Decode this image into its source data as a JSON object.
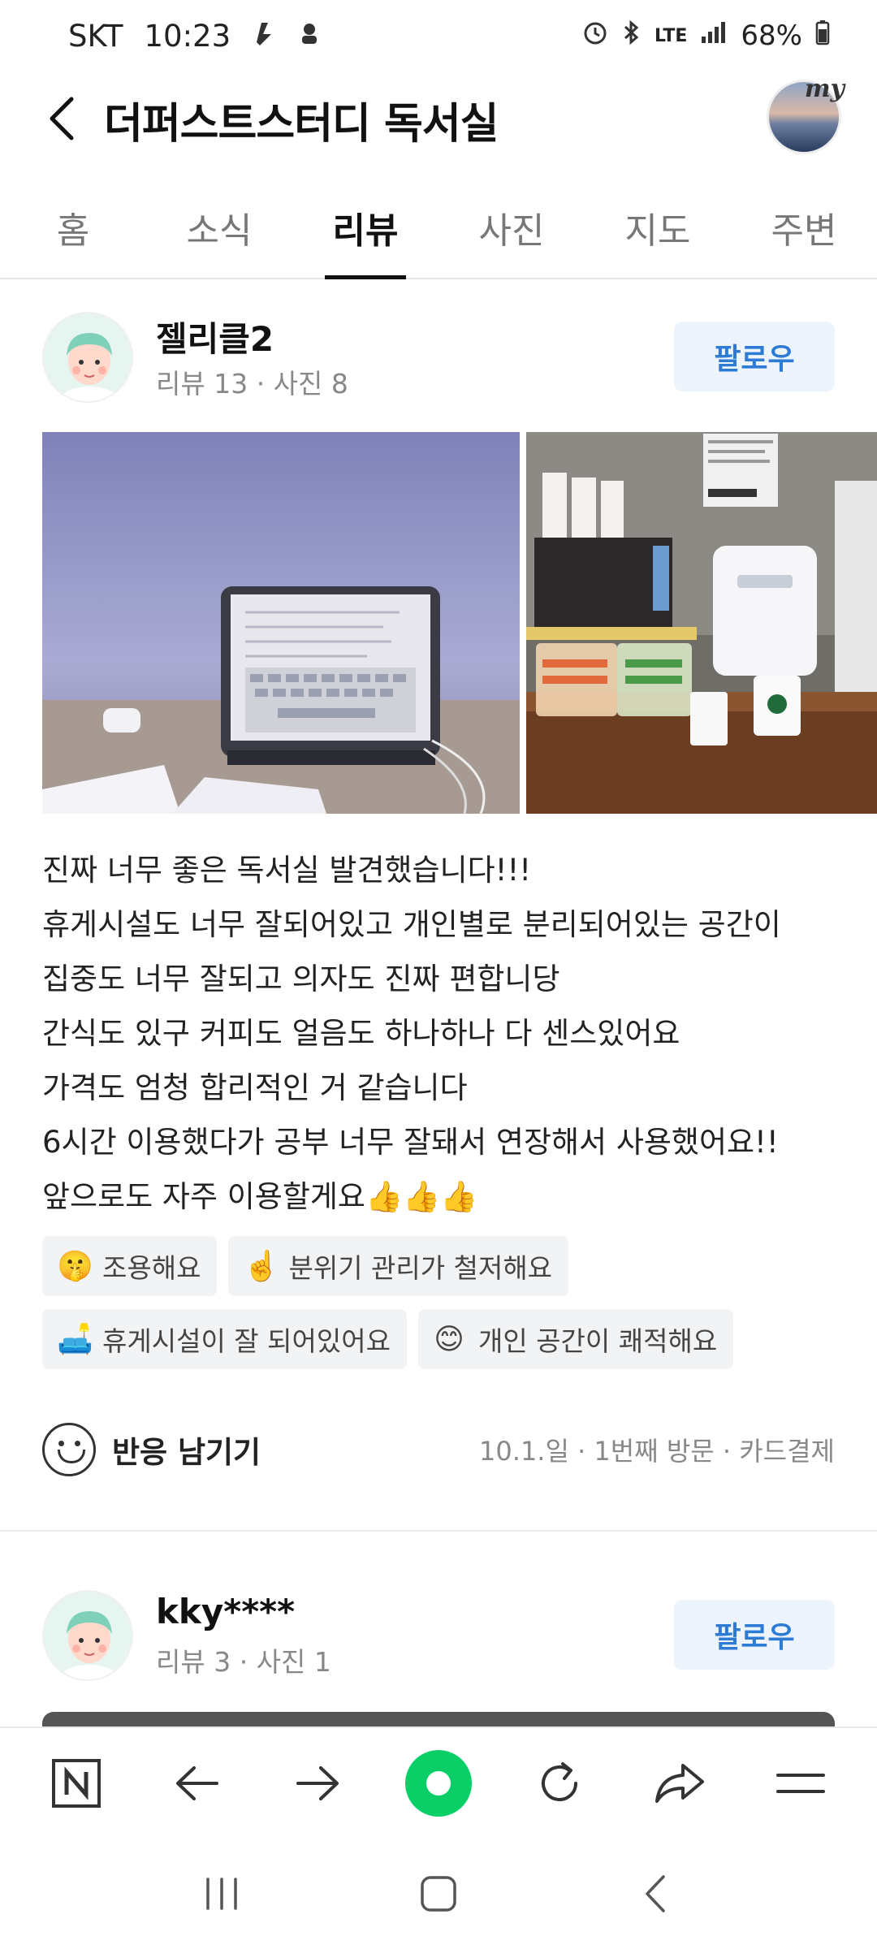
{
  "status_bar": {
    "carrier": "SKT",
    "time": "10:23",
    "network": "LTE",
    "battery": "68%"
  },
  "header": {
    "title": "더퍼스트스터디 독서실",
    "my_label": "my"
  },
  "tabs": [
    {
      "label": "홈"
    },
    {
      "label": "소식"
    },
    {
      "label": "리뷰",
      "active": true
    },
    {
      "label": "사진"
    },
    {
      "label": "지도"
    },
    {
      "label": "주변"
    }
  ],
  "reviews": [
    {
      "author": "젤리클2",
      "meta": "리뷰 13 · 사진 8",
      "follow_label": "팔로우",
      "text_lines": [
        "진짜 너무 좋은 독서실 발견했습니다!!!",
        "휴게시설도 너무 잘되어있고 개인별로 분리되어있는 공간이",
        "집중도 너무 잘되고 의자도 진짜 편합니당",
        "간식도 있구 커피도 얼음도 하나하나 다 센스있어요",
        "가격도 엄청 합리적인 거 같습니다",
        "6시간 이용했다가 공부 너무 잘돼서 연장해서 사용했어요!!",
        "앞으로도 자주 이용할게요"
      ],
      "thumbs": "👍👍👍",
      "keywords": [
        {
          "emoji": "🤫",
          "label": "조용해요"
        },
        {
          "emoji": "☝️",
          "label": "분위기 관리가 철저해요"
        },
        {
          "emoji": "🛋️",
          "label": "휴게시설이 잘 되어있어요"
        },
        {
          "emoji": "😊",
          "label": "개인 공간이 쾌적해요"
        }
      ],
      "reaction_label": "반응 남기기",
      "visit_meta": "10.1.일 · 1번째 방문 · 카드결제"
    },
    {
      "author": "kky****",
      "meta": "리뷰 3 · 사진 1",
      "follow_label": "팔로우"
    }
  ],
  "browser_bar": {
    "buttons": [
      "naver-home-icon",
      "back-arrow-icon",
      "forward-arrow-icon",
      "green-dot-icon",
      "refresh-icon",
      "share-icon",
      "menu-icon"
    ]
  },
  "colors": {
    "follow_text": "#2e7bd6",
    "follow_bg": "#eef4fc",
    "green_accent": "#0acf66"
  }
}
